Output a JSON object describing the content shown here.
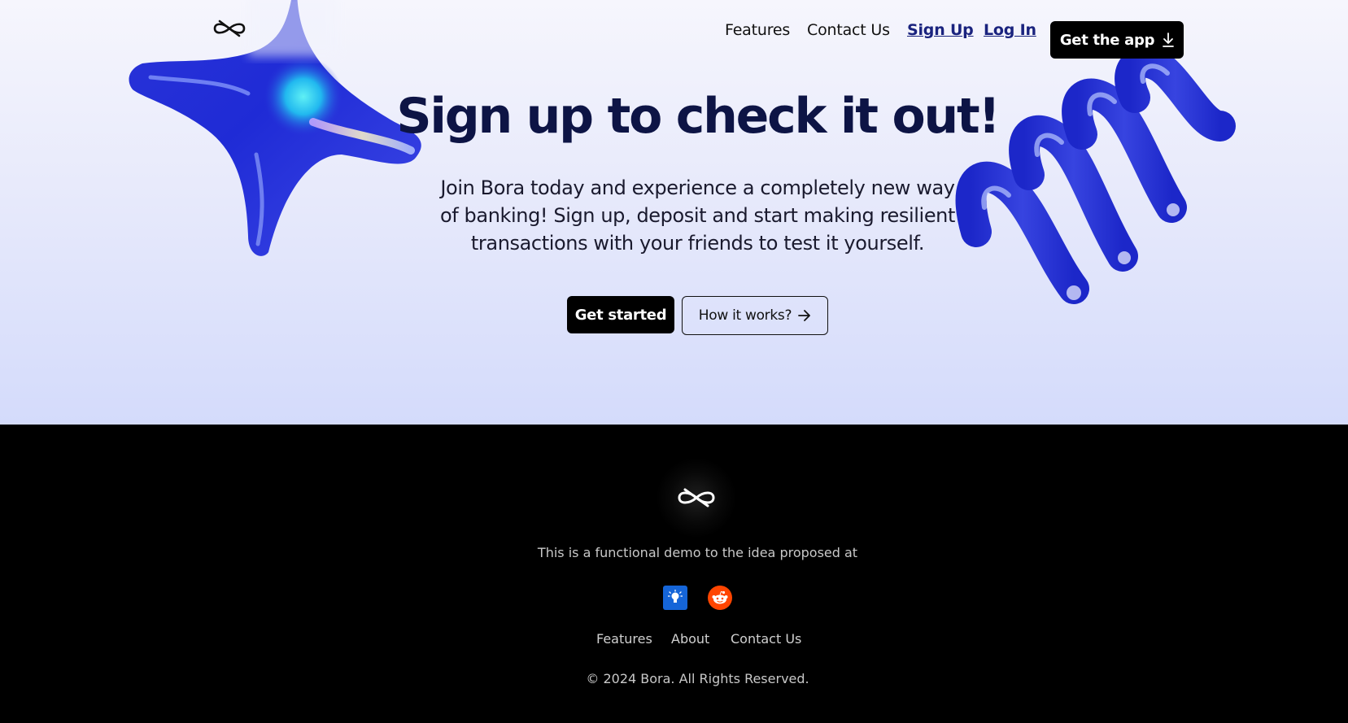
{
  "nav": {
    "links": [
      "Features",
      "Contact Us"
    ],
    "sign_up": "Sign Up",
    "log_in": "Log In",
    "get_app": "Get the app"
  },
  "hero": {
    "title": "Sign up to check it out!",
    "lead": "Join Bora today and experience a completely new way of banking! Sign up, deposit and start making resilient transactions with your friends to test it yourself.",
    "get_started": "Get started",
    "how_it_works": "How it works?"
  },
  "footer": {
    "demo_text": "This is a functional demo to the idea proposed at",
    "links": [
      "Features",
      "About",
      "Contact Us"
    ],
    "copyright": "© 2024 Bora. All Rights Reserved."
  },
  "colors": {
    "heading": "#0d1445",
    "link_accent": "#1a237e",
    "button_bg": "#000000",
    "hero_gradient_top": "#f6f6fd",
    "hero_gradient_bottom": "#d4dbfb",
    "footer_bg": "#000000",
    "bulb_icon_bg": "#1565d8",
    "reddit_icon_bg": "#ff4500"
  },
  "icons": [
    "bora-logo-icon",
    "download-icon",
    "arrow-right-icon",
    "lightbulb-icon",
    "reddit-icon"
  ]
}
